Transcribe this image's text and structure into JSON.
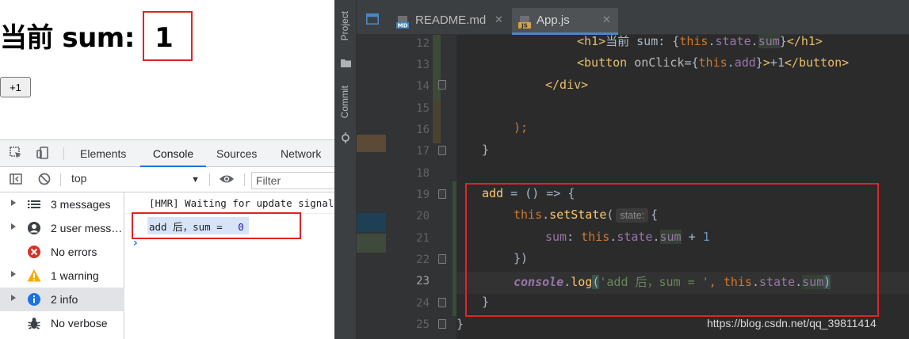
{
  "page": {
    "heading_prefix": "当前 sum: ",
    "sum_value": "1",
    "increment_button": "+1"
  },
  "devtools": {
    "tabs": [
      "Elements",
      "Console",
      "Sources",
      "Network"
    ],
    "active_tab": "Console",
    "context": "top",
    "filter_placeholder": "Filter",
    "sidebar": [
      {
        "label": "3 messages",
        "icon": "list-icon",
        "expandable": true
      },
      {
        "label": "2 user mess…",
        "icon": "user-icon",
        "expandable": true
      },
      {
        "label": "No errors",
        "icon": "error-icon",
        "expandable": false
      },
      {
        "label": "1 warning",
        "icon": "warning-icon",
        "expandable": true
      },
      {
        "label": "2 info",
        "icon": "info-icon",
        "expandable": true,
        "selected": true
      },
      {
        "label": "No verbose",
        "icon": "bug-icon",
        "expandable": false
      }
    ],
    "console": {
      "hmr": "[HMR] Waiting for update signal",
      "log_text": "add 后，sum = ",
      "log_value": "0",
      "prompt": "›"
    }
  },
  "ide": {
    "strip": {
      "project": "Project",
      "commit": "Commit"
    },
    "tabs": [
      {
        "name": "README.md",
        "badge": "MD"
      },
      {
        "name": "App.js",
        "badge": "JS",
        "active": true
      }
    ],
    "line_numbers": [
      "12",
      "13",
      "14",
      "15",
      "16",
      "17",
      "18",
      "19",
      "20",
      "21",
      "22",
      "23",
      "24",
      "25"
    ],
    "current_line": "23",
    "param_hint": "state:",
    "watermark": "https://blog.csdn.net/qq_39811414"
  },
  "colors": {
    "annotation_red": "#e02424",
    "ide_bg": "#2b2b2b",
    "devtools_accent": "#1a73e8"
  }
}
